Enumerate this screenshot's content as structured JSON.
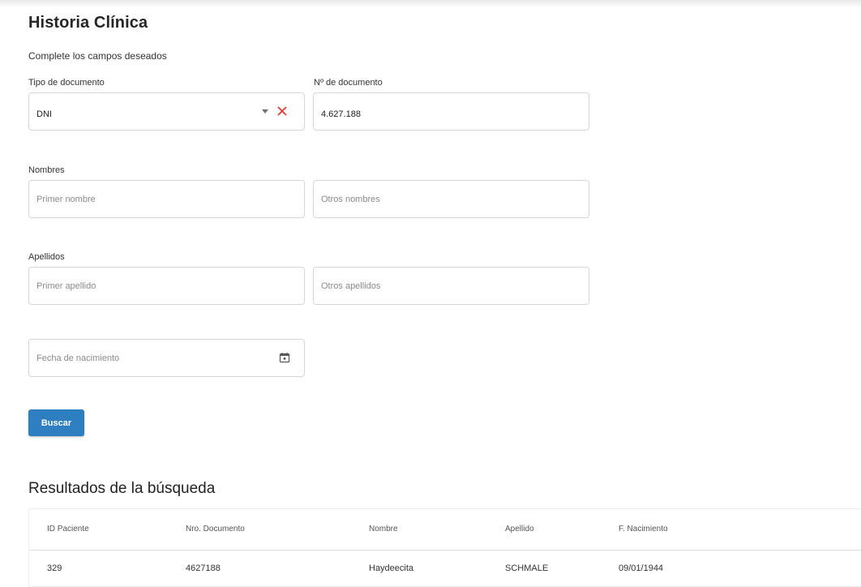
{
  "page": {
    "title": "Historia Clínica",
    "subtitle": "Complete los campos deseados"
  },
  "form": {
    "document_type": {
      "label": "Tipo de documento",
      "value": "DNI"
    },
    "document_number": {
      "label": "Nº de documento",
      "value": "4.627.188"
    },
    "names": {
      "label": "Nombres",
      "first_placeholder": "Primer nombre",
      "other_placeholder": "Otros nombres"
    },
    "surnames": {
      "label": "Apellidos",
      "first_placeholder": "Primer apellido",
      "other_placeholder": "Otros apellidos"
    },
    "birth_date": {
      "placeholder": "Fecha de nacimiento"
    },
    "search_button": "Buscar"
  },
  "results": {
    "title": "Resultados de la búsqueda",
    "columns": [
      "ID Paciente",
      "Nro. Documento",
      "Nombre",
      "Apellido",
      "F. Nacimiento"
    ],
    "rows": [
      [
        "329",
        "4627188",
        "Haydeecita",
        "SCHMALE",
        "09/01/1944"
      ]
    ]
  },
  "icons": {
    "document_type_caret": "caret-down-icon",
    "document_type_clear": "close-icon",
    "birth_date": "calendar-icon"
  },
  "colors": {
    "primary_button": "#2d7fc2",
    "clear_icon": "#e53935"
  }
}
